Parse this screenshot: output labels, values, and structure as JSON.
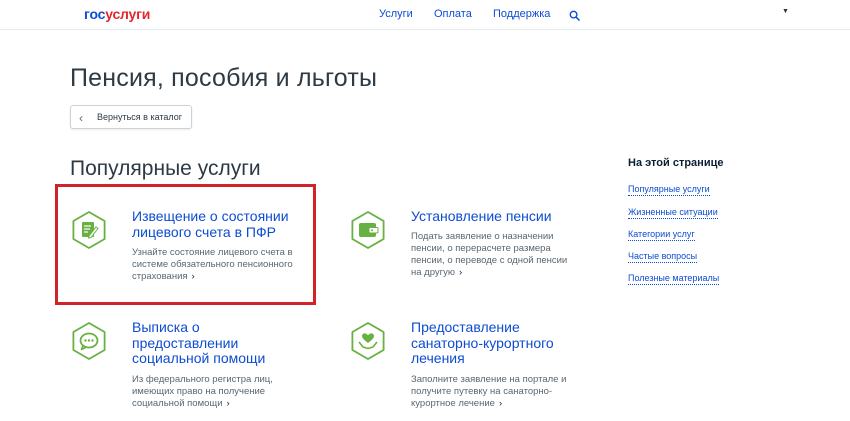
{
  "header": {
    "logo_part1": "гос",
    "logo_part2": "услуги",
    "nav": [
      "Услуги",
      "Оплата",
      "Поддержка"
    ]
  },
  "page_title": "Пенсия, пособия и льготы",
  "back_button": "Вернуться в каталог",
  "section_title": "Популярные услуги",
  "services": [
    {
      "title": "Извещение о состоянии лицевого счета в ПФР",
      "desc": "Узнайте состояние лицевого счета в системе обязательного пенсионного страхования",
      "arrow": "›",
      "icon": "document-edit-icon"
    },
    {
      "title": "Установление пенсии",
      "desc": "Подать заявление о назначении пенсии, о перерасчете размера пенсии, о переводе с одной пенсии на другую",
      "arrow": "›",
      "icon": "wallet-icon"
    },
    {
      "title": "Выписка о предоставлении социальной помощи",
      "desc": "Из федерального регистра лиц, имеющих право на получение социальной помощи",
      "arrow": "›",
      "icon": "chat-bubble-icon"
    },
    {
      "title": "Предоставление санаторно-курортного лечения",
      "desc": "Заполните заявление на портале и получите путевку на санаторно-курортное лечение",
      "arrow": "›",
      "icon": "heart-hands-icon"
    }
  ],
  "sidebar": {
    "title": "На этой странице",
    "links": [
      "Популярные услуги",
      "Жизненные ситуации",
      "Категории услуг",
      "Частые вопросы",
      "Полезные материалы"
    ]
  },
  "colors": {
    "link": "#0d4cd3",
    "icon_green": "#69b042",
    "highlight": "#d2232a",
    "logo_red": "#e3262f"
  }
}
